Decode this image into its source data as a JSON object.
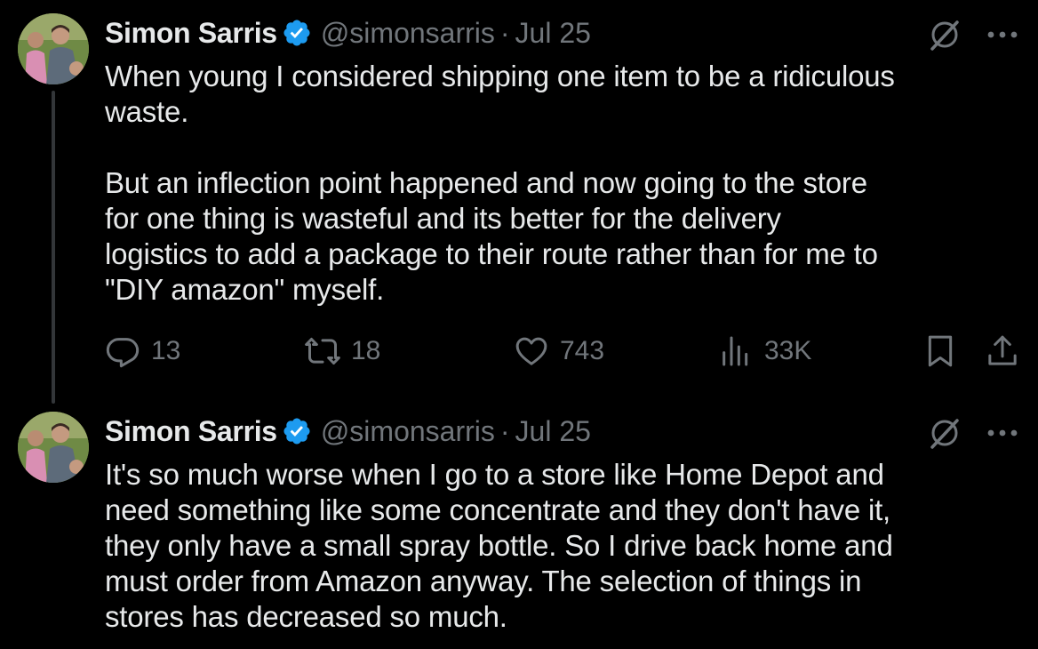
{
  "tweets": [
    {
      "author_name": "Simon Sarris",
      "handle": "@simonsarris",
      "separator": "·",
      "date": "Jul 25",
      "text": "When young I considered shipping one item to be a ridiculous\nwaste.\n\nBut an inflection point happened and now going to the store\nfor one thing is wasteful and its better for the delivery\nlogistics to add a package to their route rather than for me to\n\"DIY amazon\" myself.",
      "reply_count": "13",
      "retweet_count": "18",
      "like_count": "743",
      "view_count": "33K"
    },
    {
      "author_name": "Simon Sarris",
      "handle": "@simonsarris",
      "separator": "·",
      "date": "Jul 25",
      "text": "It's so much worse when I go to a store like Home Depot and\nneed something like some concentrate and they don't have it,\nthey only have a small spray bottle. So I drive back home and\nmust order from Amazon anyway. The selection of things in\nstores has decreased so much."
    }
  ],
  "colors": {
    "background": "#000000",
    "primary_text": "#e7e9ea",
    "secondary_text": "#71767b",
    "verified_badge": "#1d9bf0",
    "thread_line": "#333639"
  },
  "icons": {
    "verified": "verified-badge-icon",
    "grok": "grok-icon",
    "more": "more-horizontal-icon",
    "reply": "reply-icon",
    "retweet": "retweet-icon",
    "like": "heart-icon",
    "views": "analytics-icon",
    "bookmark": "bookmark-icon",
    "share": "share-icon"
  }
}
